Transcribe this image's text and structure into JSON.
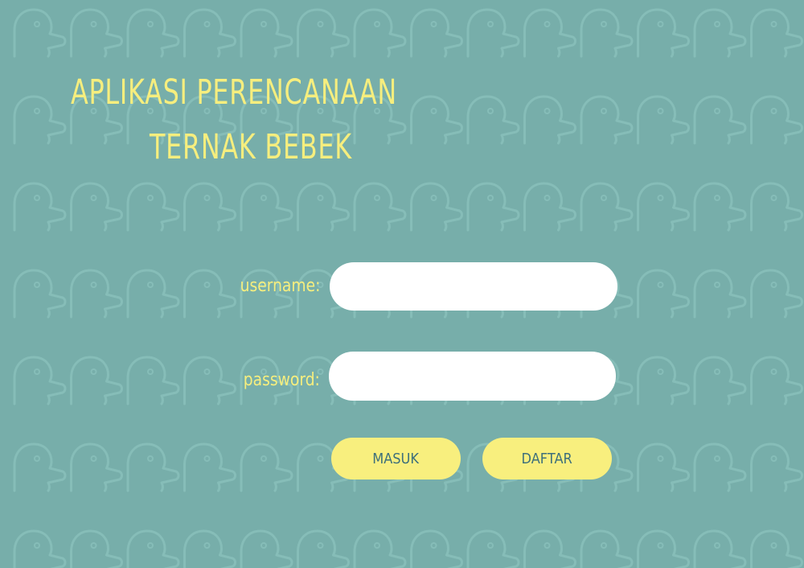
{
  "title": {
    "line1": "APLIKASI PERENCANAAN",
    "line2": "TERNAK BEBEK"
  },
  "form": {
    "username_label": "username:",
    "username_value": "",
    "password_label": "password:",
    "password_value": ""
  },
  "buttons": {
    "masuk_label": "MASUK",
    "daftar_label": "DAFTAR"
  },
  "colors": {
    "background": "#77aeaa",
    "pattern_stroke": "#86bdb8",
    "title": "#f6ee7e",
    "button_bg": "#f8ef7e",
    "button_text": "#3d6f7b"
  },
  "background_pattern_icon": "duck-icon"
}
